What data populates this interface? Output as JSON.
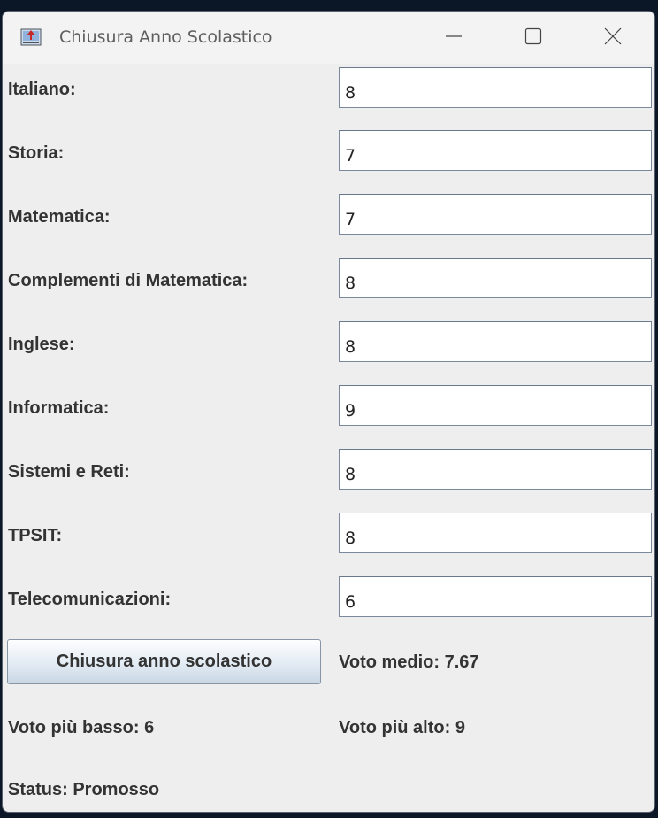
{
  "window": {
    "title": "Chiusura Anno Scolastico",
    "icon": "java-app-icon",
    "controls": [
      "minimize-icon",
      "maximize-icon",
      "close-icon"
    ]
  },
  "subjects": [
    {
      "label": "Italiano:",
      "value": "8"
    },
    {
      "label": "Storia:",
      "value": "7"
    },
    {
      "label": "Matematica:",
      "value": "7"
    },
    {
      "label": "Complementi di Matematica:",
      "value": "8"
    },
    {
      "label": "Inglese:",
      "value": "8"
    },
    {
      "label": "Informatica:",
      "value": "9"
    },
    {
      "label": "Sistemi e Reti:",
      "value": "8"
    },
    {
      "label": "TPSIT:",
      "value": "8"
    },
    {
      "label": "Telecomunicazioni:",
      "value": "6"
    }
  ],
  "action": {
    "button_label": "Chiusura anno scolastico"
  },
  "results": {
    "average": "Voto medio: 7.67",
    "lowest": "Voto più basso: 6",
    "highest": "Voto più alto: 9",
    "status": "Status: Promosso"
  }
}
